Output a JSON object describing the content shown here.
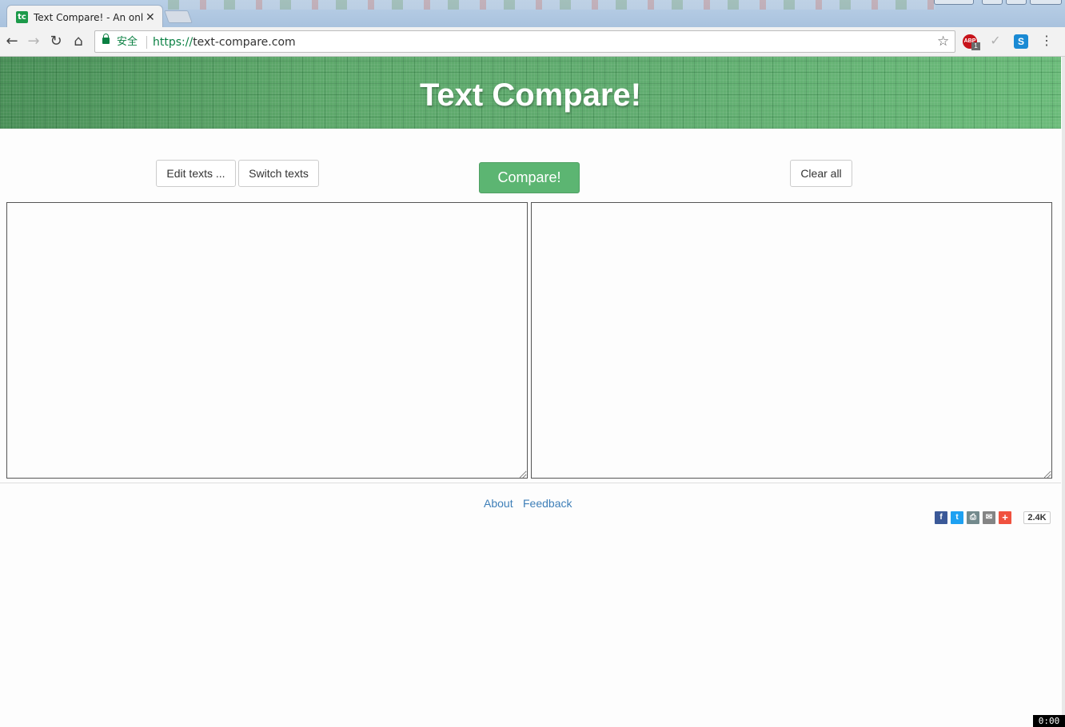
{
  "browser": {
    "tab_title": "Text Compare! - An onl",
    "tab_favicon_text": "tc",
    "security_label": "安全",
    "url_scheme": "https://",
    "url_host": "text-compare.com",
    "abp_badge": "1",
    "abp_label": "ABP",
    "ext_s_label": "S"
  },
  "banner": {
    "title": "Text Compare!"
  },
  "toolbar": {
    "edit_texts": "Edit texts ...",
    "switch_texts": "Switch texts",
    "compare": "Compare!",
    "clear_all": "Clear all"
  },
  "editors": {
    "left_value": "",
    "right_value": ""
  },
  "footer": {
    "about": "About",
    "feedback": "Feedback"
  },
  "share": {
    "count": "2.4K",
    "buttons": [
      "facebook",
      "twitter",
      "print",
      "email",
      "more"
    ],
    "colors": {
      "facebook": "#3b5998",
      "twitter": "#1da1f2",
      "print": "#738a8d",
      "email": "#848484",
      "more": "#f0523f"
    }
  },
  "overlay": {
    "timer": "0:00"
  },
  "colors": {
    "banner": "#5aaa6a",
    "compare_button": "#5cb572",
    "link": "#3e7fb8"
  }
}
